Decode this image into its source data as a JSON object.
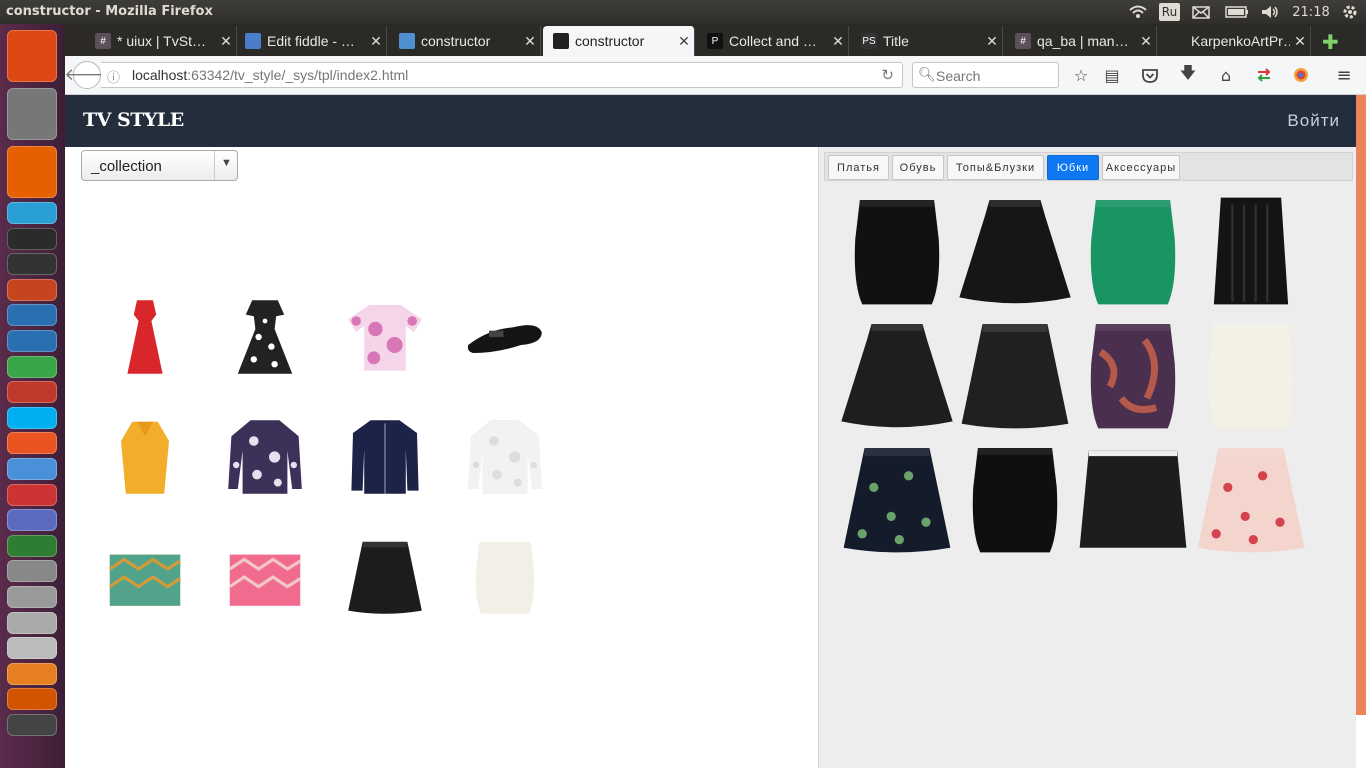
{
  "system": {
    "window_title": "constructor - Mozilla Firefox",
    "keyboard_layout": "Ru",
    "clock": "21:18"
  },
  "launcher": {
    "items": [
      "dash-home",
      "files",
      "firefox",
      "webstorm",
      "pycharm",
      "terminal",
      "impress",
      "mail",
      "writer",
      "calc",
      "document-viewer",
      "skype",
      "software-center",
      "browser",
      "stacer",
      "workspace",
      "text-editor",
      "update",
      "folder-1",
      "folder-2",
      "folder-3",
      "install",
      "filezilla",
      "website-copier"
    ]
  },
  "browser": {
    "tabs": [
      {
        "label": "* uiux | TvSt…",
        "favicon": "hash-icon",
        "fav_color": "#5b4f58"
      },
      {
        "label": "Edit fiddle - …",
        "favicon": "fiddle-icon",
        "fav_color": "#4b7ec9"
      },
      {
        "label": "constructor",
        "favicon": "chrome-icon",
        "fav_color": "#4d8fd1"
      },
      {
        "label": "constructor",
        "favicon": "pycharm-icon",
        "fav_color": "#222",
        "active": true
      },
      {
        "label": "Collect and …",
        "favicon": "p-icon",
        "fav_color": "#111"
      },
      {
        "label": "Title",
        "favicon": "ps-icon",
        "fav_color": "#333"
      },
      {
        "label": "qa_ba | man…",
        "favicon": "hash-icon",
        "fav_color": "#5b4f58"
      },
      {
        "label": "KarpenkoArtPr…",
        "favicon": "none",
        "fav_color": "#2b2a27"
      }
    ],
    "url_host": "localhost",
    "url_rest": ":63342/tv_style/_sys/tpl/index2.html",
    "search_placeholder": "Search"
  },
  "app": {
    "brand": "TV STYLE",
    "login": "Войти",
    "collection_select": "_collection",
    "categories": [
      {
        "label": "Платья",
        "active": false
      },
      {
        "label": "Обувь",
        "active": false
      },
      {
        "label": "Топы&Блузки",
        "active": false
      },
      {
        "label": "Юбки",
        "active": true
      },
      {
        "label": "Аксессуары",
        "active": false
      }
    ],
    "collection_items": [
      {
        "kind": "dress-long",
        "color": "#d8262b",
        "name": "red-maxi-dress"
      },
      {
        "kind": "dress",
        "color": "#222",
        "color2": "#fff",
        "name": "floral-black-dress"
      },
      {
        "kind": "top",
        "color": "#d777b8",
        "color2": "#f5d5ea",
        "name": "pink-floral-top"
      },
      {
        "kind": "shoe",
        "color": "#151515",
        "name": "black-loafer"
      },
      {
        "kind": "blouse",
        "color": "#f2ad2a",
        "name": "yellow-blouse"
      },
      {
        "kind": "shirt",
        "color": "#3b3159",
        "color2": "#e9e0ef",
        "name": "paisley-shirt"
      },
      {
        "kind": "jacket",
        "color": "#1c2347",
        "name": "navy-jacket"
      },
      {
        "kind": "shirt",
        "color": "#f2f2f2",
        "color2": "#ddd",
        "name": "white-shirt"
      },
      {
        "kind": "clutch",
        "color": "#3aa59a",
        "color2": "#d39a3a",
        "name": "teal-clutch"
      },
      {
        "kind": "clutch",
        "color": "#ee5a83",
        "color2": "#f3c6c8",
        "name": "pink-clutch"
      },
      {
        "kind": "skirt-a",
        "color": "#1c1c1c",
        "name": "black-leather-skirt"
      },
      {
        "kind": "skirt-pencil",
        "color": "#f1efe6",
        "name": "white-pencil-skirt"
      }
    ],
    "skirts": [
      {
        "kind": "skirt-pencil",
        "color": "#111",
        "name": "black-pencil-skirt"
      },
      {
        "kind": "skirt-flare",
        "color": "#161616",
        "name": "black-flared-skirt"
      },
      {
        "kind": "skirt-pencil",
        "color": "#1a9463",
        "name": "green-pencil-skirt"
      },
      {
        "kind": "skirt-pleat",
        "color": "#141414",
        "name": "black-pleated-skirt"
      },
      {
        "kind": "skirt-flare",
        "color": "#1e1e1e",
        "name": "black-textured-skirt"
      },
      {
        "kind": "skirt-a",
        "color": "#202020",
        "name": "black-leather-skirt"
      },
      {
        "kind": "skirt-pencil",
        "color": "#4a2f4f",
        "color2": "#b55a4a",
        "name": "paisley-pencil-skirt"
      },
      {
        "kind": "skirt-pencil",
        "color": "#f3f1e6",
        "name": "white-lace-skirt"
      },
      {
        "kind": "skirt-a",
        "color": "#141b2a",
        "color2": "#6aa36a",
        "name": "floral-navy-skirt"
      },
      {
        "kind": "skirt-pencil",
        "color": "#0f0f0f",
        "name": "black-slit-skirt"
      },
      {
        "kind": "skirt-mini",
        "color": "#1d1d1d",
        "name": "black-belted-skirt"
      },
      {
        "kind": "skirt-a",
        "color": "#f3d5cd",
        "color2": "#d5434d",
        "name": "floral-pink-skirt"
      }
    ]
  }
}
